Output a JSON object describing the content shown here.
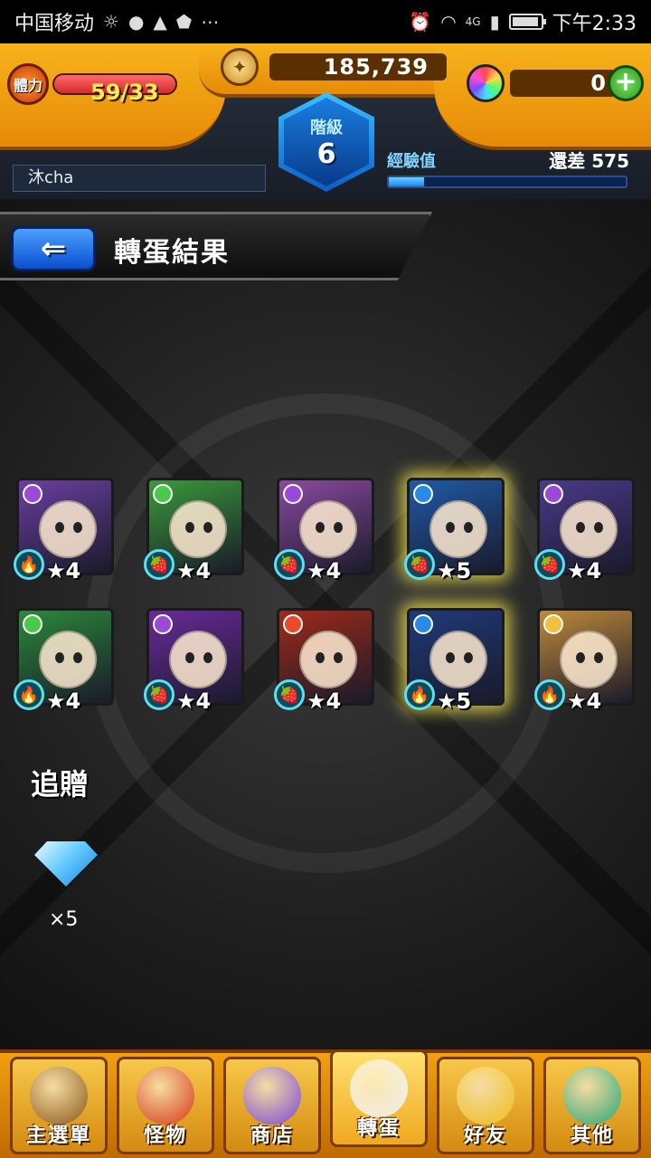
{
  "status_bar": {
    "carrier": "中国移动",
    "network": "4G",
    "time": "下午2:33"
  },
  "hud": {
    "stamina_label": "體力",
    "stamina": "59/33",
    "stamina_fraction": 1.0,
    "coins": "185,739",
    "gems": "0",
    "rank_label": "階級",
    "rank": "6",
    "player_name": "沐cha",
    "exp_label": "經驗值",
    "exp_remaining": "還差 575",
    "exp_fraction": 0.15
  },
  "title": "轉蛋結果",
  "monsters": [
    {
      "stars": "★4",
      "bg": "#6a3fa0",
      "attr": "#9a4ad8",
      "glow": false
    },
    {
      "stars": "★4",
      "bg": "#3a9a3a",
      "attr": "#4ac84a",
      "glow": false
    },
    {
      "stars": "★4",
      "bg": "#8a4aa0",
      "attr": "#9a4ad8",
      "glow": false
    },
    {
      "stars": "★5",
      "bg": "#1f5aa8",
      "attr": "#2a8ae8",
      "glow": true
    },
    {
      "stars": "★4",
      "bg": "#4a3a8a",
      "attr": "#9a4ad8",
      "glow": false
    },
    {
      "stars": "★4",
      "bg": "#2a8a3a",
      "attr": "#4ac84a",
      "glow": false
    },
    {
      "stars": "★4",
      "bg": "#6a2a9a",
      "attr": "#9a4ad8",
      "glow": false
    },
    {
      "stars": "★4",
      "bg": "#a02a1a",
      "attr": "#e84a2a",
      "glow": false
    },
    {
      "stars": "★5",
      "bg": "#1f3a7a",
      "attr": "#2a8ae8",
      "glow": true
    },
    {
      "stars": "★4",
      "bg": "#c08a3a",
      "attr": "#f0c040",
      "glow": false
    }
  ],
  "bonus": {
    "label": "追贈",
    "gem_count": "×5"
  },
  "nav": [
    {
      "label": "主選單",
      "icon": "castle-icon",
      "color": "#8a5a1a"
    },
    {
      "label": "怪物",
      "icon": "monster-icon",
      "color": "#d83a1a"
    },
    {
      "label": "商店",
      "icon": "rainbow-orb-icon",
      "color": "#7a4ad8"
    },
    {
      "label": "轉蛋",
      "icon": "egg-icon",
      "color": "#f0f0f0"
    },
    {
      "label": "好友",
      "icon": "balloons-icon",
      "color": "#f0c020"
    },
    {
      "label": "其他",
      "icon": "diamond-icon",
      "color": "#2aa87a"
    }
  ]
}
